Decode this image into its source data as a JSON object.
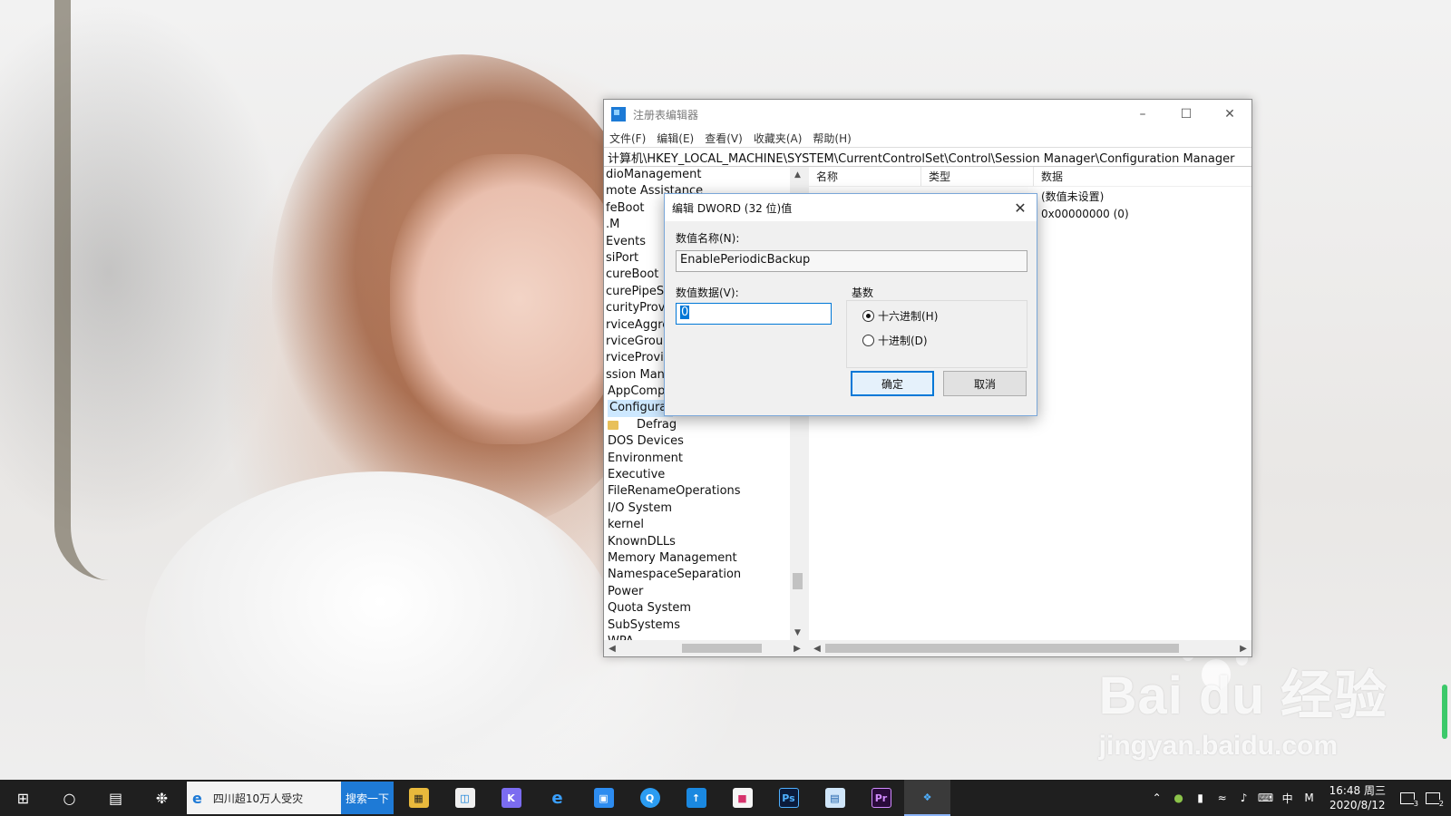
{
  "colors": {
    "accent": "#0078d7",
    "taskbar": "#1f1f1f",
    "search_button": "#1e7ad6"
  },
  "regedit": {
    "title": "注册表编辑器",
    "menu": [
      "文件(F)",
      "编辑(E)",
      "查看(V)",
      "收藏夹(A)",
      "帮助(H)"
    ],
    "address": "计算机\\HKEY_LOCAL_MACHINE\\SYSTEM\\CurrentControlSet\\Control\\Session Manager\\Configuration Manager",
    "tree_items": [
      "dioManagement",
      "mote Assistance",
      "feBoot",
      ".M",
      "Events",
      "siPort",
      "cureBoot",
      "curePipeSe",
      "curityProvi",
      "rviceAggre",
      "rviceGroup",
      "rviceProvid",
      "ssion Mana",
      "AppComp",
      "Configurat",
      "Defrag",
      "DOS Devices",
      "Environment",
      "Executive",
      "FileRenameOperations",
      "I/O System",
      "kernel",
      "KnownDLLs",
      "Memory Management",
      "NamespaceSeparation",
      "Power",
      "Quota System",
      "SubSystems",
      "WPA"
    ],
    "selected_index": 14,
    "folder_icon_index": 15,
    "columns": {
      "name": "名称",
      "type": "类型",
      "data": "数据"
    },
    "values": [
      {
        "name": "",
        "type": "",
        "data": "(数值未设置)"
      },
      {
        "name": "",
        "type": "",
        "data": "0x00000000 (0)"
      }
    ]
  },
  "dialog": {
    "title": "编辑 DWORD (32 位)值",
    "value_name_label": "数值名称(N):",
    "value_name": "EnablePeriodicBackup",
    "value_data_label": "数值数据(V):",
    "value_data": "0",
    "base_label": "基数",
    "hex_label": "十六进制(H)",
    "dec_label": "十进制(D)",
    "selected_base": "hex",
    "ok": "确定",
    "cancel": "取消"
  },
  "taskbar": {
    "search_text": "四川超10万人受灾",
    "search_button": "搜索一下",
    "apps": [
      "file-explorer",
      "store",
      "app-k",
      "edge",
      "app-calendar",
      "app-q",
      "app-arrow",
      "app-gallery",
      "Ps",
      "app-window",
      "Pr",
      "regedit"
    ],
    "ime": "中",
    "ime_mode": "M",
    "time": "16:48 周三",
    "date": "2020/8/12",
    "notif_count": "3",
    "action_count": "2"
  },
  "watermark": {
    "main": "Bai du 经验",
    "sub": "jingyan.baidu.com"
  }
}
